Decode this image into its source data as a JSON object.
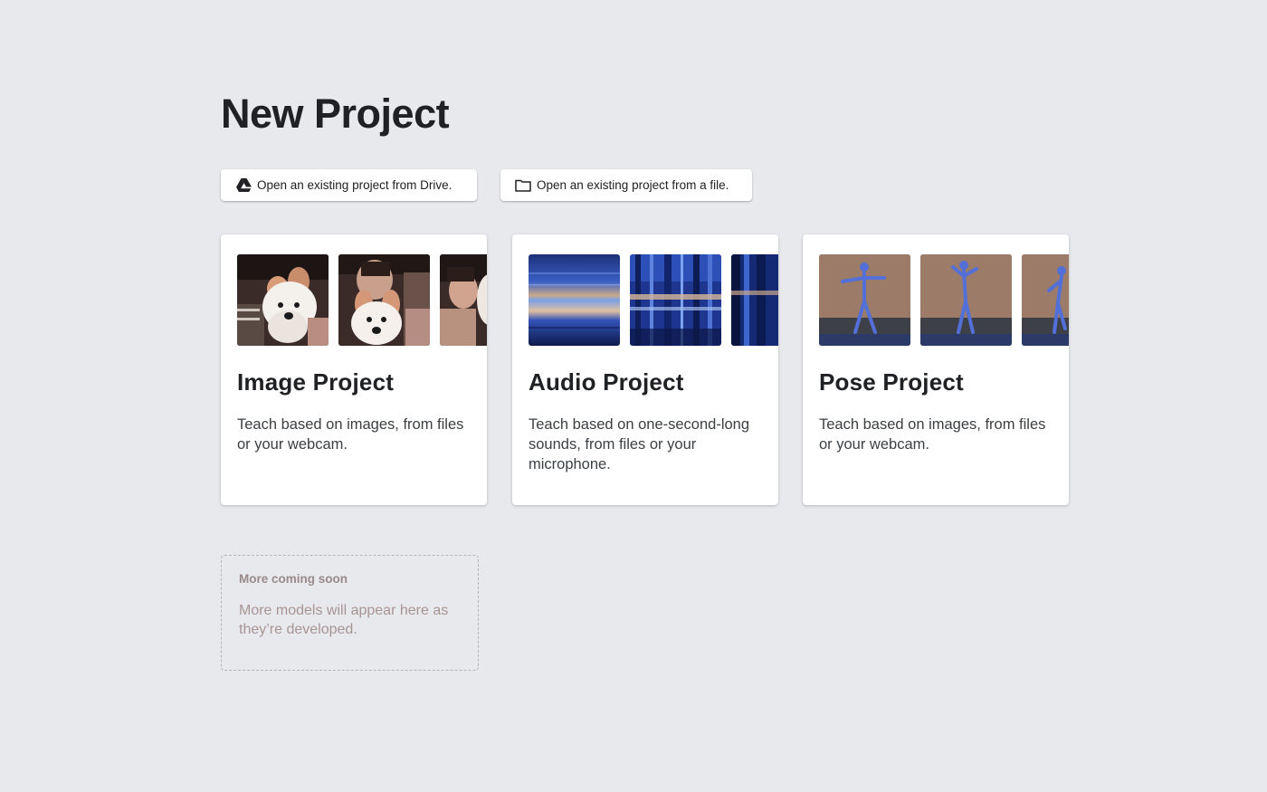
{
  "header": {
    "title": "New Project"
  },
  "open_buttons": {
    "drive": {
      "label": "Open an existing project from Drive.",
      "icon": "google-drive-icon"
    },
    "file": {
      "label": "Open an existing project from a file.",
      "icon": "folder-icon"
    }
  },
  "cards": {
    "image": {
      "title": "Image Project",
      "description": "Teach based on images, from files or your webcam."
    },
    "audio": {
      "title": "Audio Project",
      "description": "Teach based on one-second-long sounds, from files or your microphone."
    },
    "pose": {
      "title": "Pose Project",
      "description": "Teach based on images, from files or your webcam."
    }
  },
  "coming_soon": {
    "title": "More coming soon",
    "description": "More models will appear here as they’re developed."
  },
  "colors": {
    "background": "#e8e9ed",
    "card": "#ffffff",
    "text": "#202124",
    "muted": "#a99494",
    "pose_skeleton": "#4f6fe0",
    "audio_blue": "#2a4aa8"
  }
}
